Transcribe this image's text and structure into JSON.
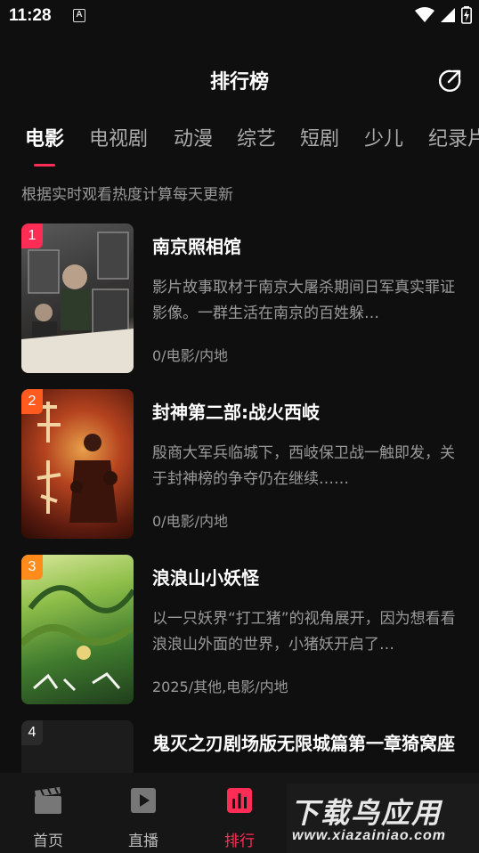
{
  "status_bar": {
    "time": "11:28",
    "notification_letter": "A"
  },
  "header": {
    "title": "排行榜"
  },
  "tabs": [
    {
      "label": "电影",
      "active": true
    },
    {
      "label": "电视剧",
      "active": false
    },
    {
      "label": "动漫",
      "active": false
    },
    {
      "label": "综艺",
      "active": false
    },
    {
      "label": "短剧",
      "active": false
    },
    {
      "label": "少儿",
      "active": false
    },
    {
      "label": "纪录片",
      "active": false
    }
  ],
  "subtitle": "根据实时观看热度计算每天更新",
  "items": [
    {
      "rank": "1",
      "title": "南京照相馆",
      "description": "影片故事取材于南京大屠杀期间日军真实罪证影像。一群生活在南京的百姓躲…",
      "meta": "0/电影/内地",
      "rank_color": "#ff2d55",
      "poster_theme": "dark-gray"
    },
    {
      "rank": "2",
      "title": "封神第二部:战火西岐",
      "description": "殷商大军兵临城下，西岐保卫战一触即发，关于封神榜的争夺仍在继续……",
      "meta": "0/电影/内地",
      "rank_color": "#ff5a1f",
      "poster_theme": "red-gold"
    },
    {
      "rank": "3",
      "title": "浪浪山小妖怪",
      "description": "以一只妖界“打工猪”的视角展开，因为想看看浪浪山外面的世界，小猪妖开启了…",
      "meta": "2025/其他,电影/内地",
      "rank_color": "#ff8c1a",
      "poster_theme": "green"
    },
    {
      "rank": "4",
      "title": "鬼灭之刃剧场版无限城篇第一章猗窝座",
      "description": "",
      "meta": "",
      "rank_color": "#2a2a2a",
      "poster_theme": "dark"
    }
  ],
  "bottom_nav": [
    {
      "label": "首页",
      "icon": "clapperboard-icon",
      "active": false
    },
    {
      "label": "直播",
      "icon": "play-icon",
      "active": false
    },
    {
      "label": "排行",
      "icon": "bar-chart-icon",
      "active": true
    }
  ],
  "watermark": {
    "main": "下载鸟应用",
    "url": "www.xiazainiao.com"
  },
  "colors": {
    "accent": "#ff2d55",
    "background": "#0f0f0f",
    "nav_background": "#161616"
  }
}
